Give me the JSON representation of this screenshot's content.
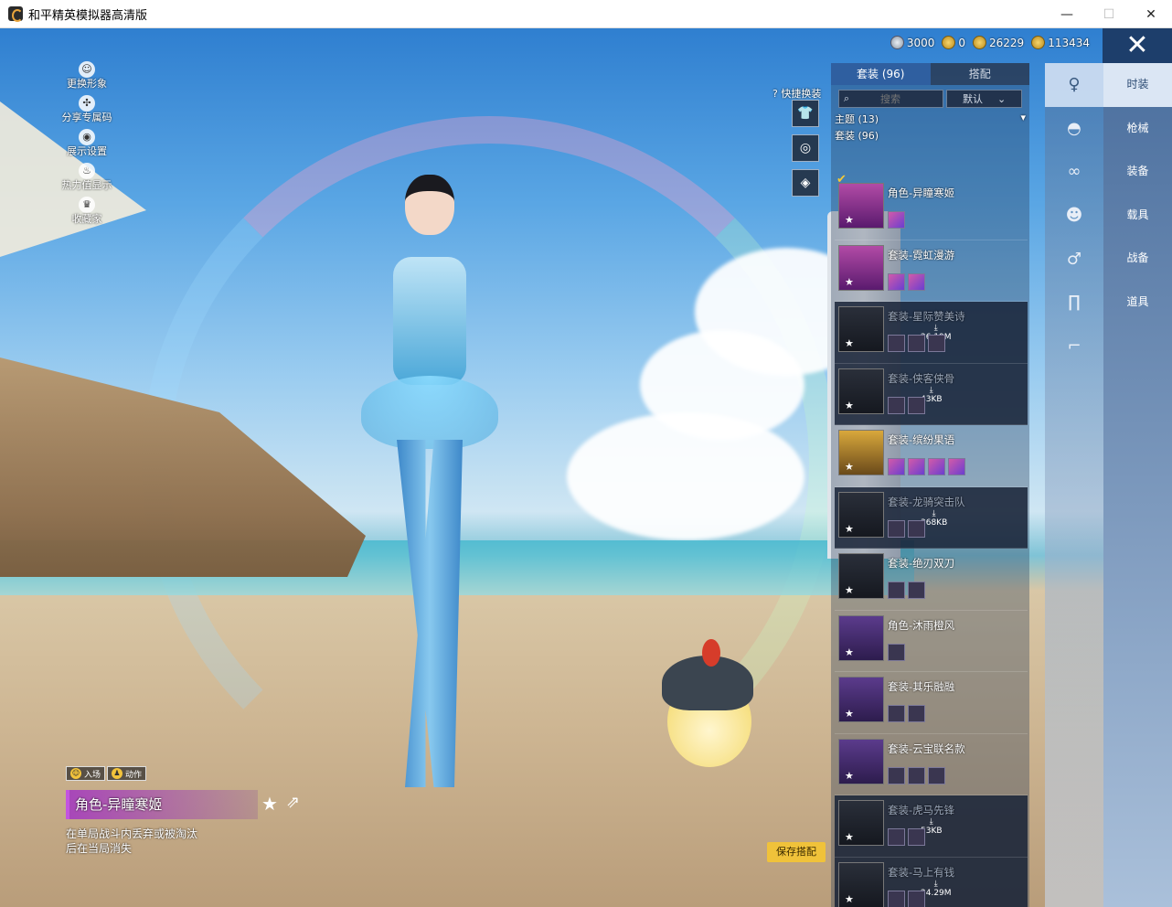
{
  "window": {
    "title": "和平精英模拟器高清版",
    "minimize": "—",
    "maximize": "☐",
    "close": "✕"
  },
  "left_menu": [
    {
      "label": "更换形象",
      "icon": "user-icon"
    },
    {
      "label": "分享专属码",
      "icon": "share-code-icon"
    },
    {
      "label": "展示设置",
      "icon": "eye-icon"
    },
    {
      "label": "热力值显示",
      "icon": "fire-icon"
    },
    {
      "label": "收藏家",
      "icon": "collector-icon"
    }
  ],
  "currency": [
    {
      "value": "3000",
      "icon": "silver-coin-icon"
    },
    {
      "value": "0",
      "icon": "gold-coin-icon"
    },
    {
      "value": "26229",
      "icon": "gold-coin-icon"
    },
    {
      "value": "113434",
      "icon": "gem-icon"
    }
  ],
  "quick_change": {
    "label": "快捷换装"
  },
  "panel": {
    "tabs": [
      "套装 (96)",
      "搭配"
    ],
    "search_placeholder": "搜索",
    "sort_value": "默认",
    "theme_label": "主题 (13)",
    "section_label": "套装 (96)",
    "outfits": [
      {
        "name": "角色-异瞳寒姬",
        "style": "selected",
        "minis": 1,
        "download": ""
      },
      {
        "name": "套装-霓虹漫游",
        "style": "pink",
        "minis": 2,
        "download": ""
      },
      {
        "name": "套装-星际赞美诗",
        "style": "dim",
        "minis": 3,
        "download": "26.19M"
      },
      {
        "name": "套装-侠客侠骨",
        "style": "dim",
        "minis": 2,
        "download": "43KB"
      },
      {
        "name": "套装-缤纷果语",
        "style": "gold",
        "minis": 4,
        "download": ""
      },
      {
        "name": "套装-龙骑突击队",
        "style": "dim",
        "minis": 2,
        "download": "368KB"
      },
      {
        "name": "套装-绝刃双刀",
        "style": "dark",
        "minis": 2,
        "download": ""
      },
      {
        "name": "角色-沐雨橙风",
        "style": "normal",
        "minis": 1,
        "download": ""
      },
      {
        "name": "套装-其乐融融",
        "style": "normal",
        "minis": 2,
        "download": ""
      },
      {
        "name": "套装-云宝联名款",
        "style": "normal",
        "minis": 3,
        "download": ""
      },
      {
        "name": "套装-虎马先锋",
        "style": "dim",
        "minis": 2,
        "download": "53KB"
      },
      {
        "name": "套装-马上有钱",
        "style": "dim",
        "minis": 2,
        "download": "24.29M"
      }
    ]
  },
  "categories": [
    {
      "label": "时装",
      "icon": "outfit-icon"
    },
    {
      "label": "枪械",
      "icon": "hat-icon"
    },
    {
      "label": "装备",
      "icon": "goggles-icon"
    },
    {
      "label": "载具",
      "icon": "mask-icon"
    },
    {
      "label": "战备",
      "icon": "body-icon"
    },
    {
      "label": "道具",
      "icon": "pants-icon"
    },
    {
      "label": "",
      "icon": "shoes-icon"
    }
  ],
  "selection": {
    "tab_enter": "入场",
    "tab_action": "动作",
    "name": "角色-异瞳寒姬",
    "desc": "在单局战斗内丢弃或被淘汰后在当局消失",
    "save_label": "保存搭配"
  },
  "colors": {
    "accent": "#2f5fa0",
    "save_button": "#f0c23a",
    "highlight": "#c354e0"
  }
}
